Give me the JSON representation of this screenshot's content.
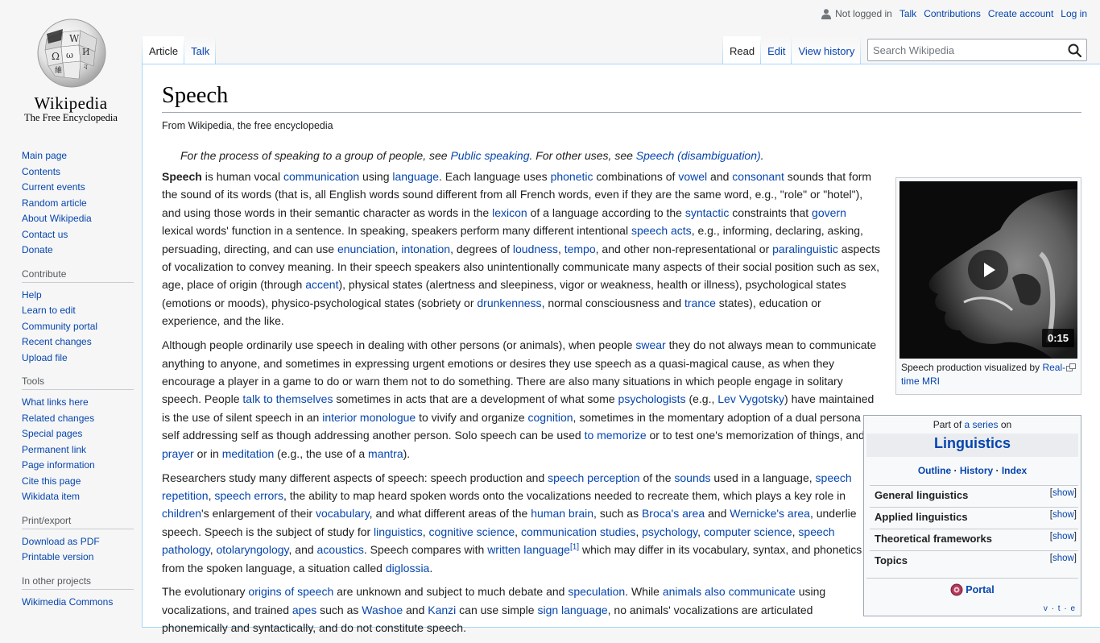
{
  "logo": {
    "wordmark": "Wikipedia",
    "tagline": "The Free Encyclopedia"
  },
  "sidebar": {
    "nav": [
      "Main page",
      "Contents",
      "Current events",
      "Random article",
      "About Wikipedia",
      "Contact us",
      "Donate"
    ],
    "contribute": {
      "heading": "Contribute",
      "items": [
        "Help",
        "Learn to edit",
        "Community portal",
        "Recent changes",
        "Upload file"
      ]
    },
    "tools": {
      "heading": "Tools",
      "items": [
        "What links here",
        "Related changes",
        "Special pages",
        "Permanent link",
        "Page information",
        "Cite this page",
        "Wikidata item"
      ]
    },
    "print": {
      "heading": "Print/export",
      "items": [
        "Download as PDF",
        "Printable version"
      ]
    },
    "projects": {
      "heading": "In other projects",
      "items": [
        "Wikimedia Commons"
      ]
    }
  },
  "personal": {
    "not_logged_in": "Not logged in",
    "talk": "Talk",
    "contributions": "Contributions",
    "create_account": "Create account",
    "login": "Log in"
  },
  "tabs": {
    "article": "Article",
    "talk": "Talk",
    "read": "Read",
    "edit": "Edit",
    "history": "View history"
  },
  "search": {
    "placeholder": "Search Wikipedia"
  },
  "article": {
    "title": "Speech",
    "subtitle": "From Wikipedia, the free encyclopedia",
    "hatnote": {
      "t1": "For the process of speaking to a group of people, see ",
      "l1": "Public speaking",
      "t2": ". For other uses, see ",
      "l2": "Speech (disambiguation)",
      "t3": "."
    },
    "p1": [
      {
        "b": "Speech"
      },
      {
        "t": " is human vocal "
      },
      {
        "a": "communication"
      },
      {
        "t": " using "
      },
      {
        "a": "language"
      },
      {
        "t": ". Each language uses "
      },
      {
        "a": "phonetic"
      },
      {
        "t": " combinations of "
      },
      {
        "a": "vowel"
      },
      {
        "t": " and "
      },
      {
        "a": "consonant"
      },
      {
        "t": " sounds that form the sound of its words (that is, all English words sound different from all French words, even if they are the same word, e.g., \"role\" or \"hotel\"), and using those words in their semantic character as words in the "
      },
      {
        "a": "lexicon"
      },
      {
        "t": " of a language according to the "
      },
      {
        "a": "syntactic"
      },
      {
        "t": " constraints that "
      },
      {
        "a": "govern"
      },
      {
        "t": " lexical words' function in a sentence. In speaking, speakers perform many different intentional "
      },
      {
        "a": "speech acts"
      },
      {
        "t": ", e.g., informing, declaring, asking, persuading, directing, and can use "
      },
      {
        "a": "enunciation"
      },
      {
        "t": ", "
      },
      {
        "a": "intonation"
      },
      {
        "t": ", degrees of "
      },
      {
        "a": "loudness"
      },
      {
        "t": ", "
      },
      {
        "a": "tempo"
      },
      {
        "t": ", and other non-representational or "
      },
      {
        "a": "paralinguistic"
      },
      {
        "t": " aspects of vocalization to convey meaning. In their speech speakers also unintentionally communicate many aspects of their social position such as sex, age, place of origin (through "
      },
      {
        "a": "accent"
      },
      {
        "t": "), physical states (alertness and sleepiness, vigor or weakness, health or illness), psychological states (emotions or moods), physico-psychological states (sobriety or "
      },
      {
        "a": "drunkenness"
      },
      {
        "t": ", normal consciousness and "
      },
      {
        "a": "trance"
      },
      {
        "t": " states), education or experience, and the like."
      }
    ],
    "p2": [
      {
        "t": "Although people ordinarily use speech in dealing with other persons (or animals), when people "
      },
      {
        "a": "swear"
      },
      {
        "t": " they do not always mean to communicate anything to anyone, and sometimes in expressing urgent emotions or desires they use speech as a quasi-magical cause, as when they encourage a player in a game to do or warn them not to do something. There are also many situations in which people engage in solitary speech. People "
      },
      {
        "a": "talk to themselves"
      },
      {
        "t": " sometimes in acts that are a development of what some "
      },
      {
        "a": "psychologists"
      },
      {
        "t": " (e.g., "
      },
      {
        "a": "Lev Vygotsky"
      },
      {
        "t": ") have maintained is the use of silent speech in an "
      },
      {
        "a": "interior monologue"
      },
      {
        "t": " to vivify and organize "
      },
      {
        "a": "cognition"
      },
      {
        "t": ", sometimes in the momentary adoption of a dual persona as self addressing self as though addressing another person. Solo speech can be used "
      },
      {
        "a": "to memorize"
      },
      {
        "t": " or to test one's memorization of things, and in "
      },
      {
        "a": "prayer"
      },
      {
        "t": " or in "
      },
      {
        "a": "meditation"
      },
      {
        "t": " (e.g., the use of a "
      },
      {
        "a": "mantra"
      },
      {
        "t": ")."
      }
    ],
    "p3": [
      {
        "t": "Researchers study many different aspects of speech: speech production and "
      },
      {
        "a": "speech perception"
      },
      {
        "t": " of the "
      },
      {
        "a": "sounds"
      },
      {
        "t": " used in a language, "
      },
      {
        "a": "speech repetition"
      },
      {
        "t": ", "
      },
      {
        "a": "speech errors"
      },
      {
        "t": ", the ability to map heard spoken words onto the vocalizations needed to recreate them, which plays a key role in "
      },
      {
        "a": "children"
      },
      {
        "t": "'s enlargement of their "
      },
      {
        "a": "vocabulary"
      },
      {
        "t": ", and what different areas of the "
      },
      {
        "a": "human brain"
      },
      {
        "t": ", such as "
      },
      {
        "a": "Broca's area"
      },
      {
        "t": " and "
      },
      {
        "a": "Wernicke's area"
      },
      {
        "t": ", underlie speech. Speech is the subject of study for "
      },
      {
        "a": "linguistics"
      },
      {
        "t": ", "
      },
      {
        "a": "cognitive science"
      },
      {
        "t": ", "
      },
      {
        "a": "communication studies"
      },
      {
        "t": ", "
      },
      {
        "a": "psychology"
      },
      {
        "t": ", "
      },
      {
        "a": "computer science"
      },
      {
        "t": ", "
      },
      {
        "a": "speech pathology"
      },
      {
        "t": ", "
      },
      {
        "a": "otolaryngology"
      },
      {
        "t": ", and "
      },
      {
        "a": "acoustics"
      },
      {
        "t": ". Speech compares with "
      },
      {
        "a": "written language"
      },
      {
        "sup": "[1]"
      },
      {
        "t": " which may differ in its vocabulary, syntax, and phonetics from the spoken language, a situation called "
      },
      {
        "a": "diglossia"
      },
      {
        "t": "."
      }
    ],
    "p4": [
      {
        "t": "The evolutionary "
      },
      {
        "a": "origins of speech"
      },
      {
        "t": " are unknown and subject to much debate and "
      },
      {
        "a": "speculation"
      },
      {
        "t": ". While "
      },
      {
        "a": "animals also communicate"
      },
      {
        "t": " using vocalizations, and trained "
      },
      {
        "a": "apes"
      },
      {
        "t": " such as "
      },
      {
        "a": "Washoe"
      },
      {
        "t": " and "
      },
      {
        "a": "Kanzi"
      },
      {
        "t": " can use simple "
      },
      {
        "a": "sign language"
      },
      {
        "t": ", no animals' vocalizations are articulated phonemically and syntactically, and do not constitute speech."
      }
    ]
  },
  "thumb": {
    "duration": "0:15",
    "caption_text": "Speech production visualized by ",
    "caption_link": "Real-time MRI"
  },
  "navbox": {
    "part_of": "Part of ",
    "series_link": "a series",
    "on": " on",
    "title": "Linguistics",
    "links": [
      "Outline",
      "History",
      "Index"
    ],
    "sections": [
      "General linguistics",
      "Applied linguistics",
      "Theoretical frameworks",
      "Topics"
    ],
    "show": "show",
    "portal": "Portal",
    "vte": [
      "v",
      "t",
      "e"
    ]
  }
}
